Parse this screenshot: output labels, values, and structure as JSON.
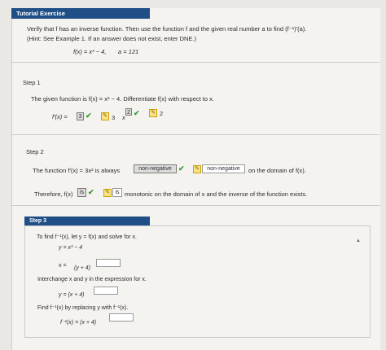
{
  "header": {
    "title": "Tutorial Exercise"
  },
  "problem": {
    "line1": "Verify that f has an inverse function. Then use the function f and the given real number a to find (f⁻¹)′(a).",
    "line2": "(Hint: See Example 1. If an answer does not exist, enter DNE.)",
    "function": "f(x) = x³ − 4,",
    "given_a": "a = 121"
  },
  "step1": {
    "label": "Step 1",
    "text": "The given function is f(x) = x³ − 4. Differentiate f(x) with respect to x.",
    "fprime_label": "f′(x) =",
    "answer_coef": "3",
    "coef_display": "3",
    "x_label": "x",
    "answer_exp": "2",
    "exp_display": "2"
  },
  "step2": {
    "label": "Step 2",
    "text_before": "The function f′(x) = 3x² is always",
    "dropdown_value": "non-negative",
    "answer_echo": "non-negative",
    "text_after": "on the domain of f(x).",
    "therefore_label": "Therefore, f(x)",
    "answer_is": "is",
    "is_echo": "is",
    "rest": "monotonic on the domain of x and the inverse of the function exists."
  },
  "step3": {
    "label": "Step 3",
    "intro": "To find f⁻¹(x), let y = f(x) and solve for x.",
    "eq1": "y = x³ − 4",
    "eq2_left": "x =",
    "eq2_right": "(y + 4)",
    "interchange": "Interchange x and y in the expression for x.",
    "eq3": "y = (x + 4)",
    "find_text": "Find f⁻¹(x) by replacing y with f⁻¹(x).",
    "eq4": "f⁻¹(x) = (x + 4)"
  },
  "icons": {
    "check": "✔",
    "pencil": "✎",
    "caret": "▲"
  }
}
